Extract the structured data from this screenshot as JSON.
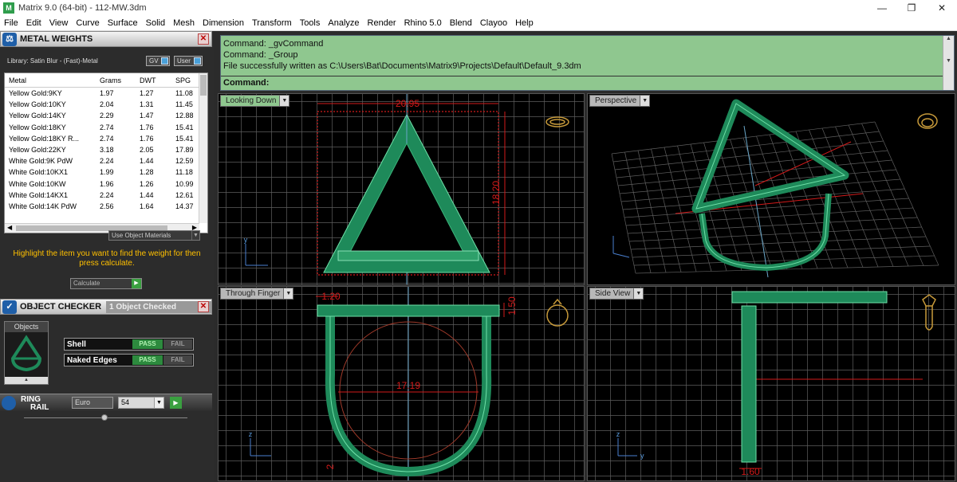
{
  "titlebar": {
    "title": "Matrix 9.0 (64-bit) - 112-MW.3dm",
    "icon": "matrix-logo",
    "minimize": "—",
    "restore": "❐",
    "close": "✕"
  },
  "menu": [
    "File",
    "Edit",
    "View",
    "Curve",
    "Surface",
    "Solid",
    "Mesh",
    "Dimension",
    "Transform",
    "Tools",
    "Analyze",
    "Render",
    "Rhino 5.0",
    "Blend",
    "Clayoo",
    "Help"
  ],
  "metal_weights": {
    "title": "METAL WEIGHTS",
    "library": "Library: Satin Blur - (Fast)-Metal",
    "toggle_gv": "GV",
    "toggle_user": "User",
    "columns": [
      "Metal",
      "Grams",
      "DWT",
      "SPG"
    ],
    "rows": [
      [
        "Yellow Gold:9KY",
        "1.97",
        "1.27",
        "11.08"
      ],
      [
        "Yellow Gold:10KY",
        "2.04",
        "1.31",
        "11.45"
      ],
      [
        "Yellow Gold:14KY",
        "2.29",
        "1.47",
        "12.88"
      ],
      [
        "Yellow Gold:18KY",
        "2.74",
        "1.76",
        "15.41"
      ],
      [
        "Yellow Gold:18KY R...",
        "2.74",
        "1.76",
        "15.41"
      ],
      [
        "Yellow Gold:22KY",
        "3.18",
        "2.05",
        "17.89"
      ],
      [
        "White Gold:9K PdW",
        "2.24",
        "1.44",
        "12.59"
      ],
      [
        "White Gold:10KX1",
        "1.99",
        "1.28",
        "11.18"
      ],
      [
        "White Gold:10KW",
        "1.96",
        "1.26",
        "10.99"
      ],
      [
        "White Gold:14KX1",
        "2.24",
        "1.44",
        "12.61"
      ],
      [
        "White Gold:14K PdW",
        "2.56",
        "1.64",
        "14.37"
      ]
    ],
    "use_object_materials": "Use Object Materials",
    "hint": "Highlight the item you want to find the weight for then press calculate.",
    "calculate": "Calculate"
  },
  "object_checker": {
    "title": "OBJECT CHECKER",
    "count": "1  Object Checked",
    "objects_label": "Objects",
    "checks": [
      {
        "name": "Shell",
        "pass": "PASS",
        "fail": "FAIL"
      },
      {
        "name": "Naked Edges",
        "pass": "PASS",
        "fail": "FAIL"
      }
    ]
  },
  "ring_rail": {
    "label_1": "RING",
    "label_2": "RAIL",
    "standard": "Euro",
    "size": "54"
  },
  "command": {
    "lines": [
      "Command: _gvCommand",
      "Command: _Group",
      "File successfully written as C:\\Users\\Bat\\Documents\\Matrix9\\Projects\\Default\\Default_9.3dm"
    ],
    "prompt": "Command:"
  },
  "viewports": {
    "top": {
      "name": "Looking Down",
      "dim_width": "20.95",
      "dim_height": "18.20",
      "axis": "y"
    },
    "perspective": {
      "name": "Perspective"
    },
    "front": {
      "name": "Through Finger",
      "dim_band": "1.20",
      "dim_thickness": "1.50",
      "dim_inner": "17.19",
      "dim_bottom": "2",
      "axis": "z"
    },
    "side": {
      "name": "Side View",
      "dim_width": "1.60",
      "axis_z": "z",
      "axis_y": "y"
    }
  },
  "colors": {
    "model_green": "#1e8a5a",
    "model_edge": "#6fe0a8",
    "dimension_red": "#d21a1a",
    "grid": "#6a6a6a",
    "command_bg": "#8fc78f",
    "hint": "#ffc000"
  }
}
